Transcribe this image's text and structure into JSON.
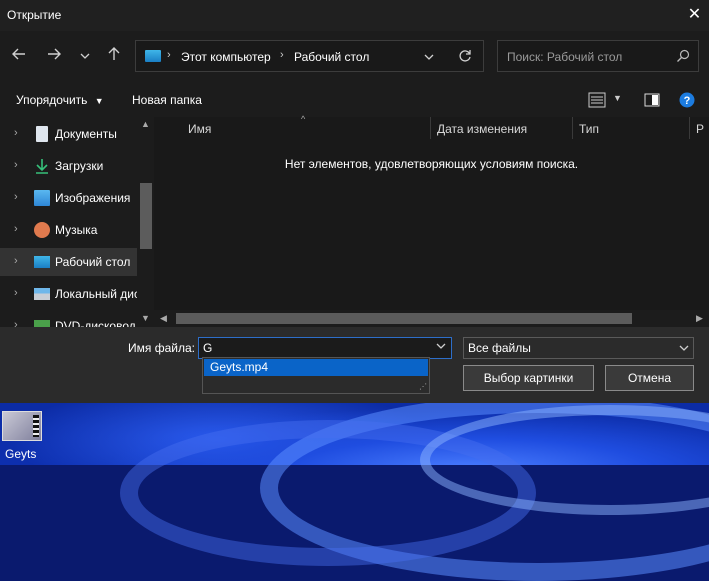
{
  "window": {
    "title": "Открытие",
    "close_glyph": "✕"
  },
  "nav": {
    "back_icon": "arrow-left-icon",
    "forward_icon": "arrow-right-icon",
    "recent_icon": "chevron-down-icon",
    "up_icon": "arrow-up-icon",
    "breadcrumb": [
      "Этот компьютер",
      "Рабочий стол"
    ],
    "search_placeholder": "Поиск: Рабочий стол"
  },
  "toolbar": {
    "organize": "Упорядочить",
    "new_folder": "Новая папка"
  },
  "sidebar": {
    "items": [
      {
        "label": "Документы",
        "icon": "documents-icon"
      },
      {
        "label": "Загрузки",
        "icon": "downloads-icon"
      },
      {
        "label": "Изображения",
        "icon": "pictures-icon"
      },
      {
        "label": "Музыка",
        "icon": "music-icon"
      },
      {
        "label": "Рабочий стол",
        "icon": "desktop-icon",
        "selected": true
      },
      {
        "label": "Локальный дис",
        "icon": "local-disk-icon"
      },
      {
        "label": "DVD-дисковод",
        "icon": "dvd-drive-icon"
      }
    ]
  },
  "file_list": {
    "columns": [
      "Имя",
      "Дата изменения",
      "Тип",
      "Р"
    ],
    "empty_message": "Нет элементов, удовлетворяющих условиям поиска."
  },
  "footer": {
    "filename_label": "Имя файла:",
    "filename_value": "G",
    "autocomplete": [
      "Geyts.mp4"
    ],
    "filetype_value": "Все файлы",
    "open_button": "Выбор картинки",
    "cancel_button": "Отмена"
  },
  "desktop": {
    "icon_label": "Geyts"
  },
  "colors": {
    "accent": "#0a64c8",
    "dialog_bg": "#202020",
    "wallpaper": "#0d2fae"
  }
}
